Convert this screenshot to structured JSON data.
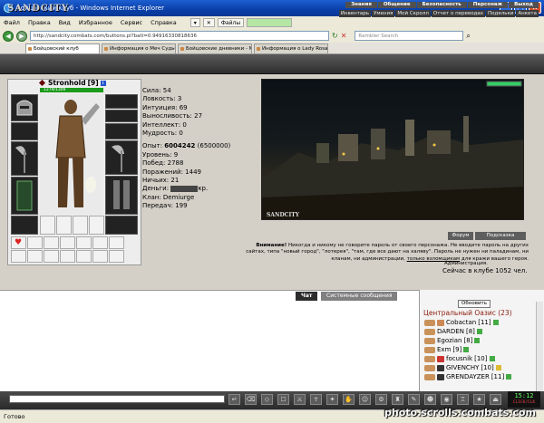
{
  "window": {
    "title": "Бойцовский клуб - Windows Internet Explorer",
    "minimize": "_",
    "maximize": "□",
    "close": "✕"
  },
  "menu": {
    "items": [
      "Файл",
      "Правка",
      "Вид",
      "Избранное",
      "Сервис",
      "Справка"
    ],
    "toolbar_files": "Файлы"
  },
  "address": {
    "url": "http://sandcity.combats.com/buttons.pl?batl=0.94916330818636",
    "search_placeholder": "Rambler Search"
  },
  "tabs": [
    "Бойцовский клуб",
    "Информация о Меч Судьбы",
    "Бойцовские дневники - Мос...",
    "Информация о Lady Rosaried"
  ],
  "game": {
    "logo": "SANDCITY",
    "top_nav": [
      "Знания",
      "Общение",
      "Безопасность",
      "Персонаж",
      "Выход"
    ],
    "sub_nav": [
      "Инвентарь",
      "Умения",
      "Мой Скролл",
      "Отчет о переводах",
      "Подельки",
      "Анкета"
    ]
  },
  "character": {
    "name": "Stronhold",
    "level": "[9]",
    "hp": "1279/1309",
    "stats": [
      {
        "label": "Сила:",
        "value": "54"
      },
      {
        "label": "Ловкость:",
        "value": "3"
      },
      {
        "label": "Интуиция:",
        "value": "69"
      },
      {
        "label": "Выносливость:",
        "value": "27"
      },
      {
        "label": "Интеллект:",
        "value": "0"
      },
      {
        "label": "Мудрость:",
        "value": "0"
      }
    ],
    "experience_label": "Опыт:",
    "experience": "6004242",
    "experience_next": "(6500000)",
    "info": [
      {
        "label": "Уровень:",
        "value": "9"
      },
      {
        "label": "Побед:",
        "value": "2788"
      },
      {
        "label": "Поражений:",
        "value": "1449"
      },
      {
        "label": "Ничьих:",
        "value": "21"
      },
      {
        "label": "Деньги:",
        "value": "кр."
      },
      {
        "label": "Клан:",
        "value": "Demiurge"
      },
      {
        "label": "Передач:",
        "value": "199"
      }
    ]
  },
  "scene": {
    "brand": "SANDCITY",
    "forum_button": "Форум",
    "hint_button": "Подсказка"
  },
  "warning": {
    "lead": "Внимание!",
    "text": " Никогда и никому не говорите пароль от своего персонажа. Не вводите пароль на других сайтах, типа \"новый город\", \"лотерея\", \"там, где все дают на халяву\". Пароль не нужен ни паладинам, ни кланам, ни администрации, ",
    "link": "только взломщикам",
    "tail": " для кражи вашего героя.",
    "signature": "Администрация.",
    "online": "Сейчас в клубе 1052 чел."
  },
  "chat": {
    "chat_tab": "Чат",
    "system_tab": "Системные сообщения"
  },
  "room": {
    "refresh_button": "Обновить",
    "title": "Центральный Оазис (23)",
    "users": [
      {
        "name": "Cobactan",
        "level": "[11]"
      },
      {
        "name": "DARDEN",
        "level": "[8]"
      },
      {
        "name": "Egozian",
        "level": "[8]"
      },
      {
        "name": "Exm",
        "level": "[9]"
      },
      {
        "name": "focusnik",
        "level": "[10]"
      },
      {
        "name": "GIVENCHY",
        "level": "[10]"
      },
      {
        "name": "GRENDAYZER",
        "level": "[11]"
      }
    ]
  },
  "clock": {
    "time": "15:12",
    "sub": "CLICK/CLK"
  },
  "status": {
    "text": "Готово"
  },
  "watermark": "photo.scrolls.combats.com",
  "colors": {
    "hp": "#1c9a1c",
    "room_title": "#8b1c0c",
    "titlebar": "#0a3fa8"
  }
}
